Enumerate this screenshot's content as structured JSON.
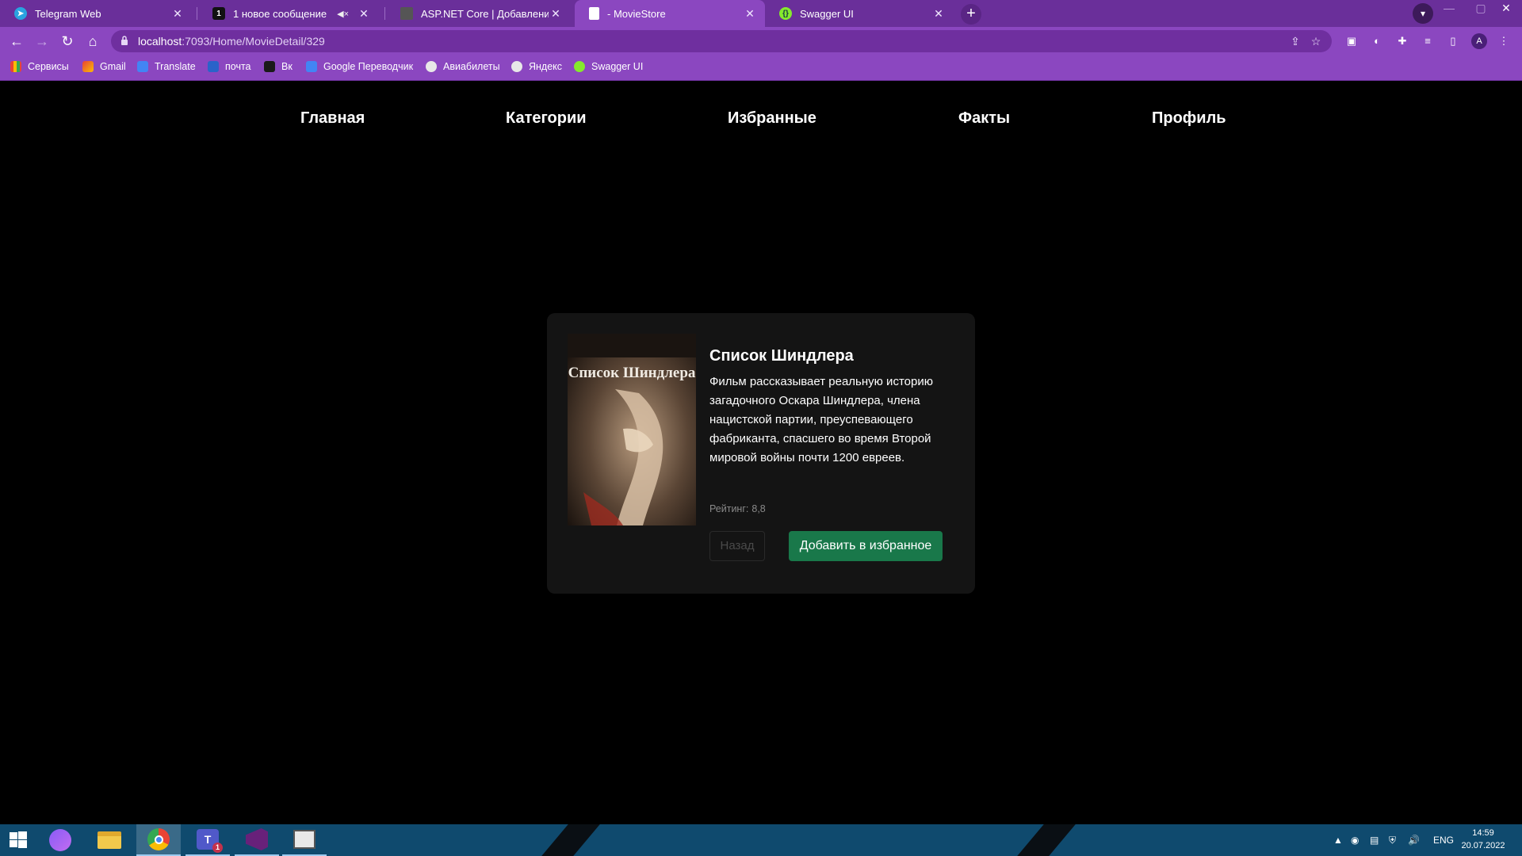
{
  "browser": {
    "tabs": [
      {
        "title": "Telegram Web",
        "icon": "telegram-icon",
        "color": "#2aa3e0"
      },
      {
        "title": "1 новое сообщение",
        "icon": "notification-icon",
        "color": "#111111"
      },
      {
        "title": "ASP.NET Core | Добавление метаданных",
        "icon": "document-icon",
        "color": "#6a6a6a"
      },
      {
        "title": "- MovieStore",
        "icon": "page-icon",
        "color": "#ffffff"
      },
      {
        "title": "Swagger UI",
        "icon": "swagger-icon",
        "color": "#85ea2d"
      }
    ],
    "active_tab": 3,
    "url_host": "localhost",
    "url_path": ":7093/Home/MovieDetail/329",
    "bookmarks": [
      {
        "label": "Сервисы",
        "icon": "apps-grid-icon"
      },
      {
        "label": "Gmail",
        "icon": "gmail-icon"
      },
      {
        "label": "Translate",
        "icon": "translate-icon"
      },
      {
        "label": "почта",
        "icon": "mail-icon"
      },
      {
        "label": "Вк",
        "icon": "vk-icon"
      },
      {
        "label": "Google Переводчик",
        "icon": "google-translate-icon"
      },
      {
        "label": "Авиабилеты",
        "icon": "globe-icon"
      },
      {
        "label": "Яндекс",
        "icon": "globe-icon"
      },
      {
        "label": "Swagger UI",
        "icon": "swagger-icon"
      }
    ],
    "profile_initial": "A",
    "theme_color": "#8b47c0"
  },
  "site": {
    "nav": [
      "Главная",
      "Категории",
      "Избранные",
      "Факты",
      "Профиль"
    ]
  },
  "movie": {
    "poster_title": "Список Шиндлера",
    "title": "Список Шиндлера",
    "description": "Фильм рассказывает реальную историю загадочного Оскара Шиндлера, члена нацистской партии, преуспевающего фабриканта, спасшего во время Второй мировой войны почти 1200 евреев.",
    "rating_label": "Рейтинг:",
    "rating_value": "8,8",
    "back_label": "Назад",
    "favorite_label": "Добавить в избранное",
    "accent": "#19784a"
  },
  "taskbar": {
    "language": "ENG",
    "time": "14:59",
    "date": "20.07.2022",
    "teams_badge": "1"
  }
}
